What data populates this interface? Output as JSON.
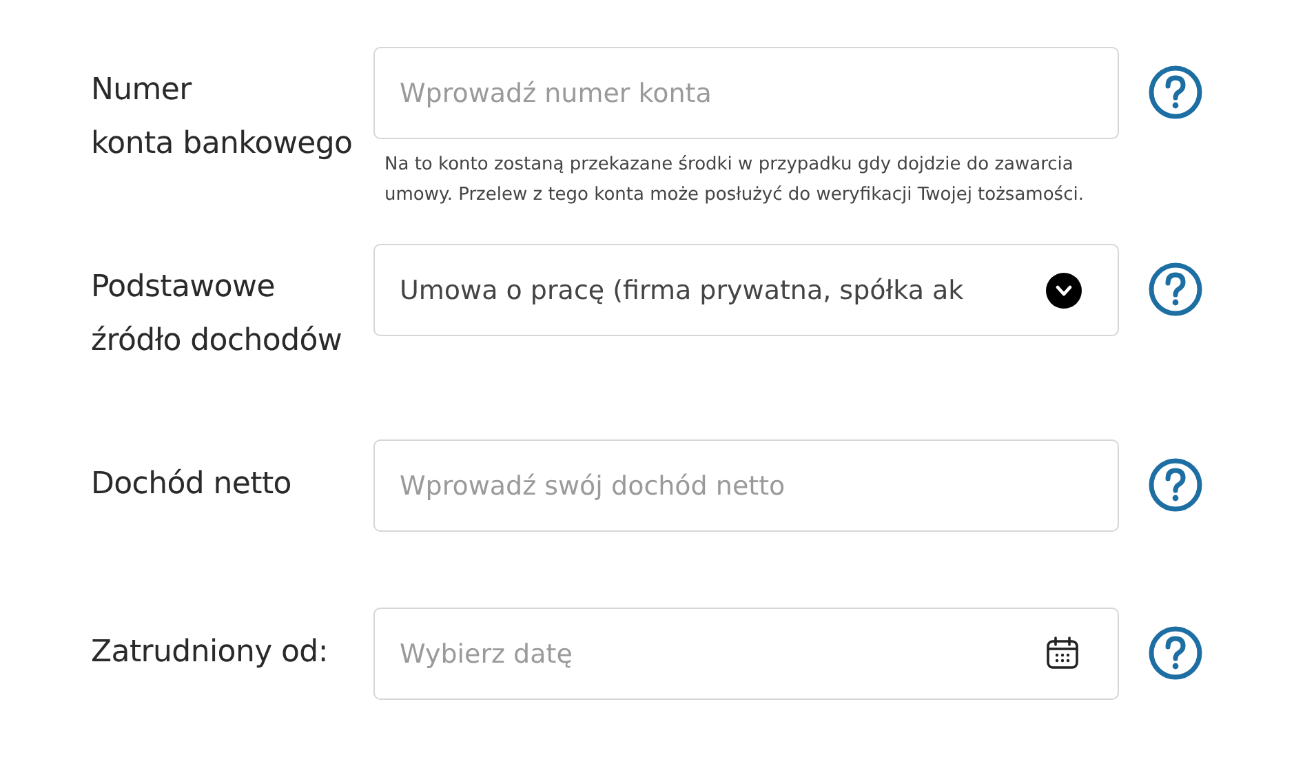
{
  "fields": [
    {
      "kind": "text",
      "label_lines": [
        "Numer",
        "konta bankowego"
      ],
      "placeholder": "Wprowadź numer konta",
      "hint": "Na to konto zostaną przekazane środki w przypadku gdy dojdzie do zawarcia umowy. Przelew z tego konta może posłużyć do weryfikacji Twojej tożsamości."
    },
    {
      "kind": "select",
      "label_lines": [
        "Podstawowe",
        "źródło dochodów"
      ],
      "value": "Umowa o pracę (firma prywatna, spółka ak"
    },
    {
      "kind": "text",
      "label_lines": [
        "Dochód netto"
      ],
      "placeholder": "Wprowadź swój dochód netto"
    },
    {
      "kind": "date",
      "label_lines": [
        "Zatrudniony od:"
      ],
      "placeholder": "Wybierz datę"
    }
  ]
}
